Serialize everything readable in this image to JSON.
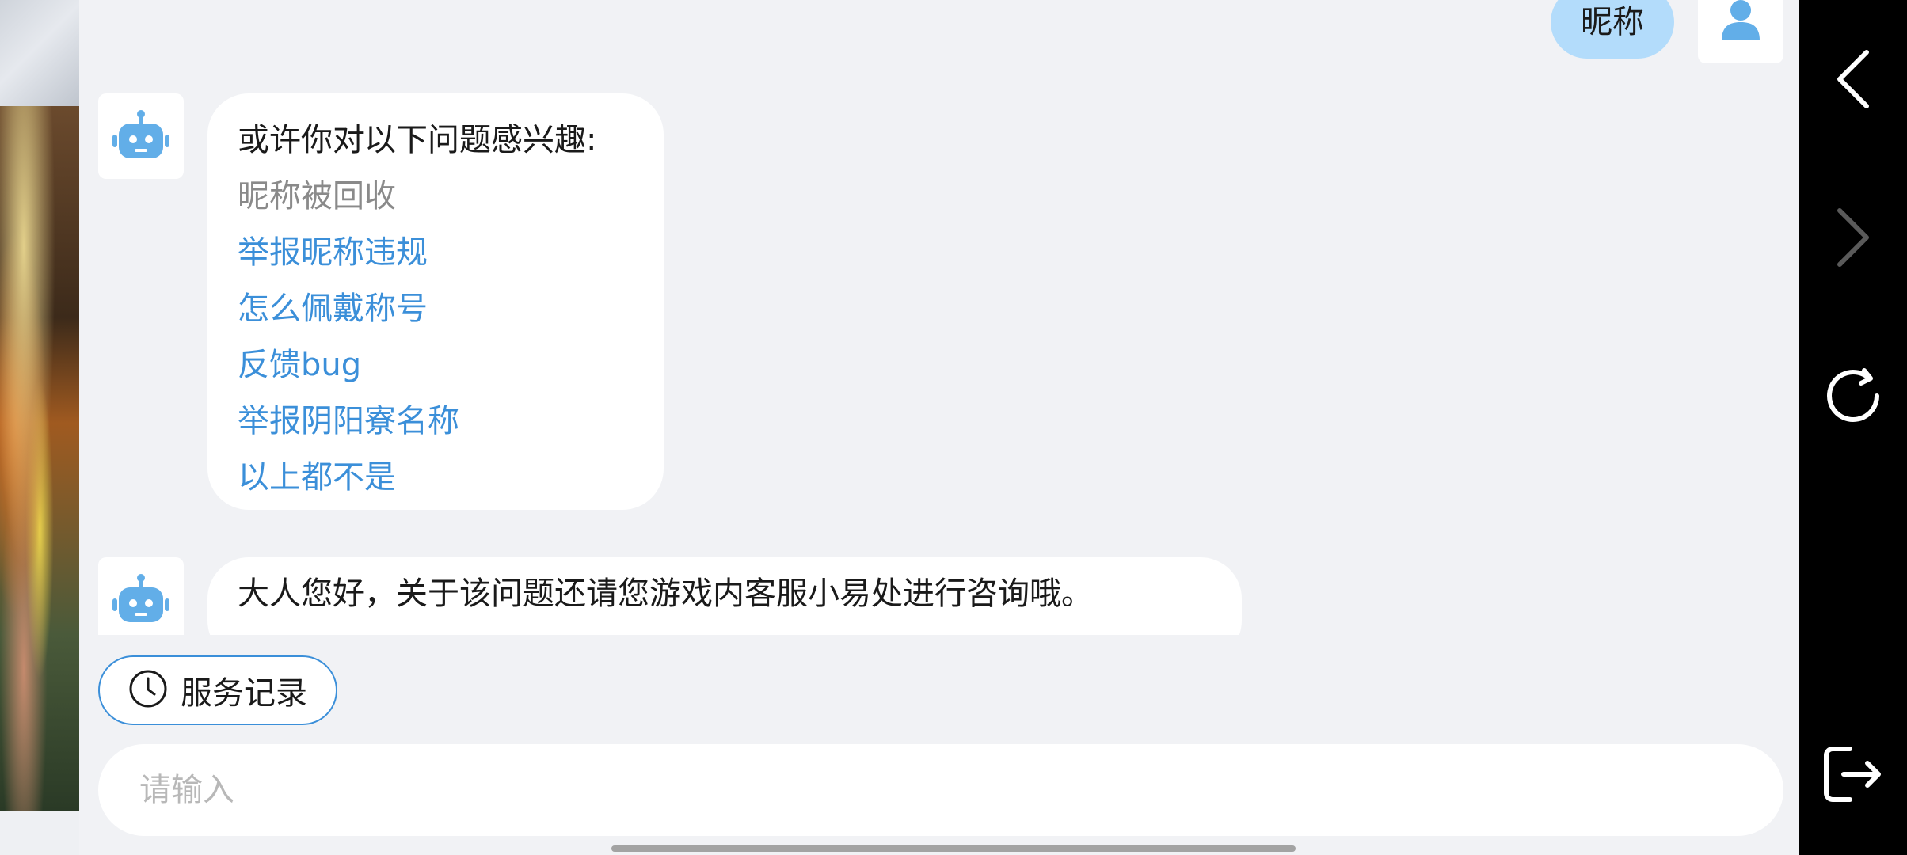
{
  "user_message": "昵称",
  "bot_suggestions": {
    "intro": "或许你对以下问题感兴趣:",
    "items": [
      {
        "label": "昵称被回收",
        "style": "muted"
      },
      {
        "label": "举报昵称违规",
        "style": "link"
      },
      {
        "label": "怎么佩戴称号",
        "style": "link"
      },
      {
        "label": "反馈bug",
        "style": "link"
      },
      {
        "label": "举报阴阳寮名称",
        "style": "link"
      },
      {
        "label": "以上都不是",
        "style": "link"
      }
    ]
  },
  "bot_reply": "大人您好，关于该问题还请您游戏内客服小易处进行咨询哦。",
  "history_button": {
    "label": "服务记录"
  },
  "input": {
    "placeholder": "请输入",
    "value": ""
  },
  "colors": {
    "accent": "#3b8fd9",
    "user_bubble": "#b3dcfb",
    "background": "#f1f2f5",
    "icon_blue": "#62aee8"
  },
  "nav_icons": [
    "back-arrow-icon",
    "forward-arrow-icon",
    "refresh-icon",
    "exit-icon"
  ]
}
